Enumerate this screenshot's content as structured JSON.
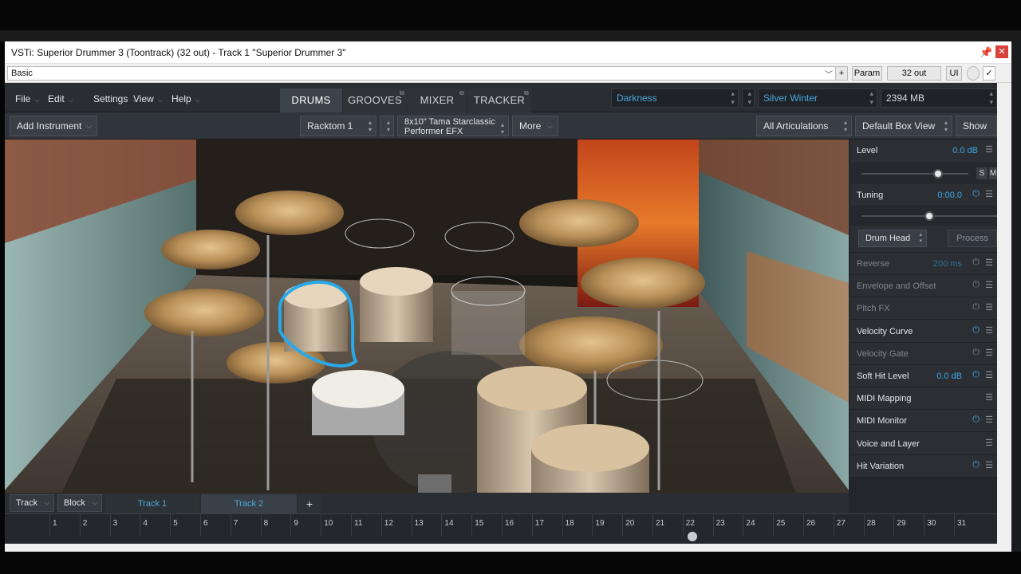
{
  "host": {
    "title": "VSTi: Superior Drummer 3 (Toontrack) (32 out) - Track 1 \"Superior Drummer 3\"",
    "preset": "Basic",
    "plus_label": "+",
    "param_label": "Param",
    "out_label": "32 out",
    "ui_label": "UI"
  },
  "menu": {
    "items": [
      "File",
      "Edit",
      "Settings",
      "View",
      "Help"
    ]
  },
  "tabs": [
    "DRUMS",
    "GROOVES",
    "MIXER",
    "TRACKER"
  ],
  "active_tab": "DRUMS",
  "kit_selector": "Darkness",
  "preset_selector": "Silver Winter",
  "memory": "2394 MB",
  "toolbar": {
    "add_instrument": "Add Instrument",
    "instrument": "Racktom 1",
    "instrument_model_line1": "8x10\" Tama Starclassic",
    "instrument_model_line2": "Performer EFX",
    "more": "More",
    "articulations": "All Articulations",
    "box_view": "Default Box View",
    "show": "Show"
  },
  "panel": {
    "level_label": "Level",
    "level_value": "0.0 dB",
    "solo": "S",
    "mute": "M",
    "tuning_label": "Tuning",
    "tuning_value": "0:00.0",
    "drum_head": "Drum Head",
    "process": "Process",
    "rows": [
      {
        "label": "Reverse",
        "value": "200 ms",
        "dim": true
      },
      {
        "label": "Envelope and Offset",
        "value": "",
        "dim": true
      },
      {
        "label": "Pitch FX",
        "value": "",
        "dim": true
      },
      {
        "label": "Velocity Curve",
        "value": "",
        "dim": false
      },
      {
        "label": "Velocity Gate",
        "value": "",
        "dim": true
      },
      {
        "label": "Soft Hit Level",
        "value": "0.0 dB",
        "dim": false
      },
      {
        "label": "MIDI Mapping",
        "value": "",
        "dim": false
      },
      {
        "label": "MIDI Monitor",
        "value": "",
        "dim": false
      },
      {
        "label": "Voice and Layer",
        "value": "",
        "dim": false
      },
      {
        "label": "Hit Variation",
        "value": "",
        "dim": false
      }
    ],
    "level_fraction": 0.72,
    "tuning_fraction": 0.5
  },
  "tracks": {
    "track_menu": "Track",
    "block_menu": "Block",
    "tabs": [
      "Track 1",
      "Track 2"
    ],
    "active": "Track 2",
    "add": "+"
  },
  "timeline": {
    "bars": [
      "1",
      "2",
      "3",
      "4",
      "5",
      "6",
      "7",
      "8",
      "9",
      "10",
      "11",
      "12",
      "13",
      "14",
      "15",
      "16",
      "17",
      "18",
      "19",
      "20",
      "21",
      "22",
      "23",
      "24",
      "25",
      "26",
      "27",
      "28",
      "29",
      "30",
      "31"
    ],
    "playhead_bar": 22
  },
  "colors": {
    "accent": "#3ea6e6",
    "selection_outline": "#29a9e8",
    "close_red": "#d9423a"
  }
}
